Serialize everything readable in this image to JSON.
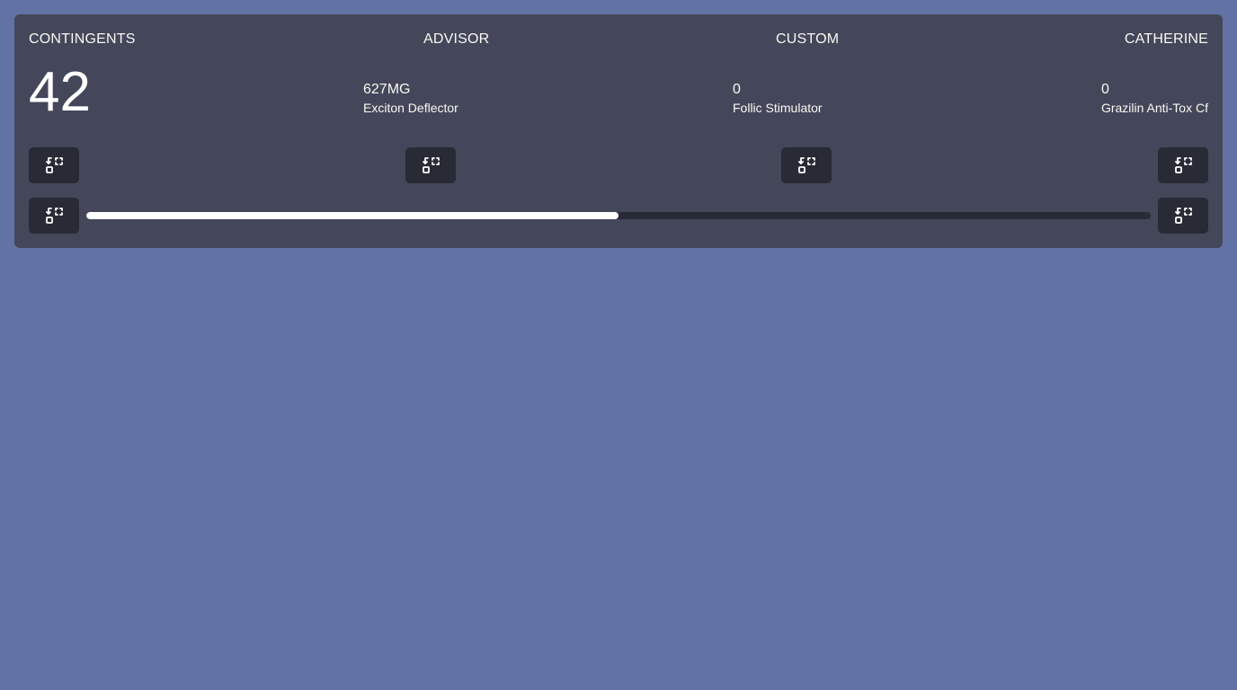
{
  "headers": [
    "CONTINGENTS",
    "ADVISOR",
    "CUSTOM",
    "CATHERINE"
  ],
  "main_value": "42",
  "stats": [
    {
      "value": "627MG",
      "label": "Exciton Deflector"
    },
    {
      "value": "0",
      "label": "Follic Stimulator"
    },
    {
      "value": "0",
      "label": "Grazilin Anti-Tox Cf"
    }
  ],
  "buttons": {
    "icon": "swap-placeholder-icon"
  },
  "progress": {
    "fraction": 0.5
  },
  "colors": {
    "background": "#6272a4",
    "card": "#44475a",
    "button": "#282a36",
    "progress_fill": "#ffffff",
    "progress_track": "#282a36"
  }
}
